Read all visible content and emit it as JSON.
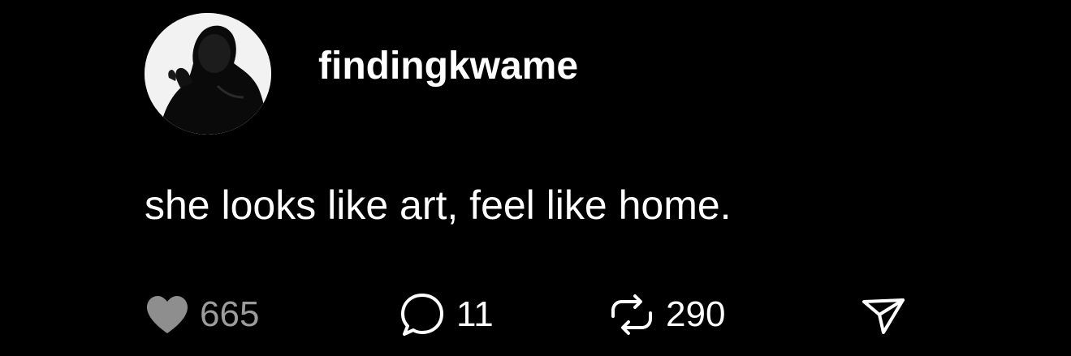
{
  "post": {
    "username": "findingkwame",
    "text": "she looks like art, feel like home.",
    "actions": {
      "like": {
        "icon": "heart-icon",
        "count": "665",
        "color": "#8e8e8e"
      },
      "reply": {
        "icon": "comment-icon",
        "count": "11"
      },
      "repost": {
        "icon": "repost-icon",
        "count": "290"
      },
      "share": {
        "icon": "send-icon"
      }
    }
  },
  "colors": {
    "background": "#000000",
    "text": "#ffffff",
    "muted": "#9c9c9c"
  }
}
